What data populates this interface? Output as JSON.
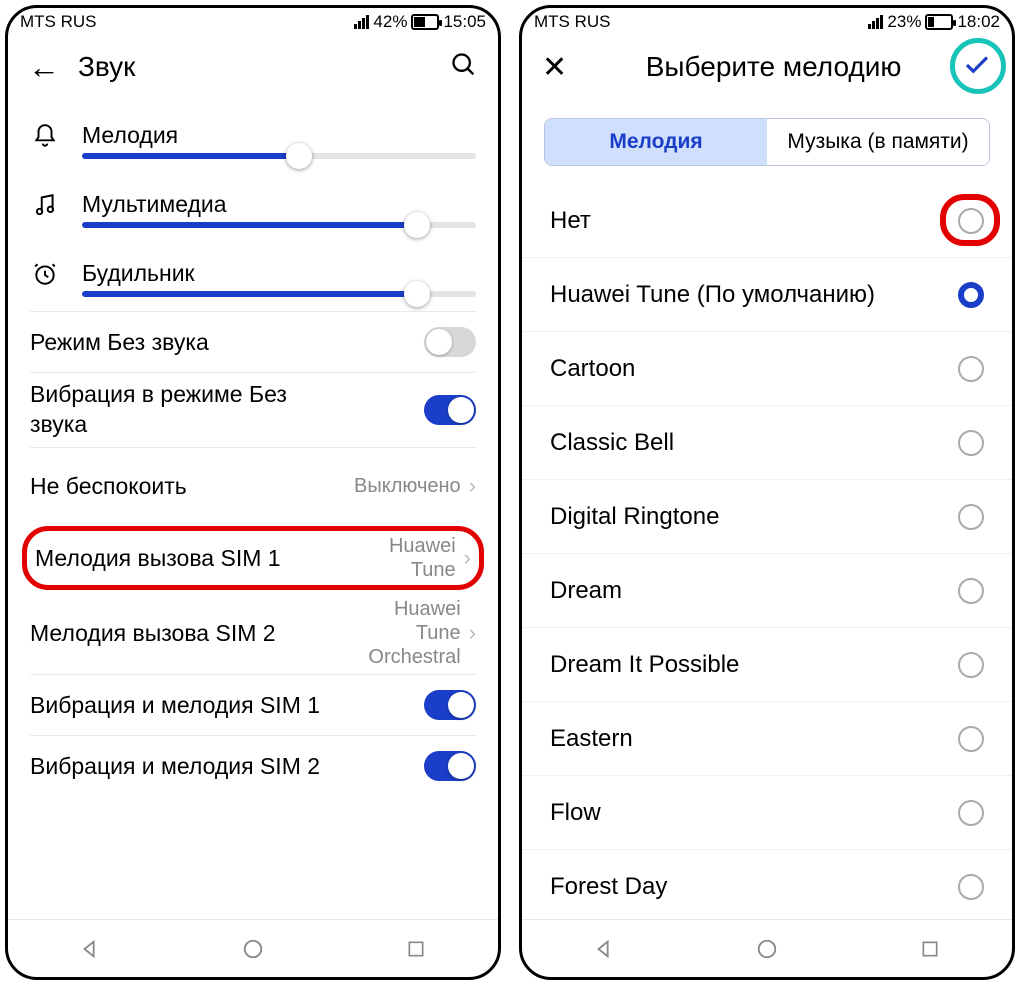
{
  "left": {
    "status": {
      "carrier": "MTS RUS",
      "battery_pct": "42%",
      "time": "15:05"
    },
    "header": {
      "title": "Звук"
    },
    "sliders": [
      {
        "label": "Мелодия",
        "value_pct": 55
      },
      {
        "label": "Мультимедиа",
        "value_pct": 85
      },
      {
        "label": "Будильник",
        "value_pct": 85
      }
    ],
    "toggles": {
      "silent": {
        "label": "Режим Без звука",
        "on": false
      },
      "vibrate_silent": {
        "label_l1": "Вибрация в режиме Без",
        "label_l2": "звука",
        "on": true
      }
    },
    "dnd": {
      "label": "Не беспокоить",
      "value": "Выключено"
    },
    "sim1": {
      "label": "Мелодия вызова SIM 1",
      "value_l1": "Huawei",
      "value_l2": "Tune"
    },
    "sim2": {
      "label": "Мелодия вызова SIM 2",
      "value_l1": "Huawei",
      "value_l2": "Tune",
      "value_l3": "Orchestral"
    },
    "vib_sim1": {
      "label": "Вибрация и мелодия SIM 1",
      "on": true
    },
    "vib_sim2": {
      "label": "Вибрация и мелодия SIM 2",
      "on": true
    }
  },
  "right": {
    "status": {
      "carrier": "MTS RUS",
      "battery_pct": "23%",
      "time": "18:02"
    },
    "header": {
      "title": "Выберите мелодию"
    },
    "tabs": {
      "melody": "Мелодия",
      "music": "Музыка (в памяти)"
    },
    "ringtones": [
      {
        "name": "Нет",
        "selected": false,
        "highlight": true
      },
      {
        "name": "Huawei Tune (По умолчанию)",
        "selected": true
      },
      {
        "name": "Cartoon",
        "selected": false
      },
      {
        "name": "Classic Bell",
        "selected": false
      },
      {
        "name": "Digital Ringtone",
        "selected": false
      },
      {
        "name": "Dream",
        "selected": false
      },
      {
        "name": "Dream It Possible",
        "selected": false
      },
      {
        "name": "Eastern",
        "selected": false
      },
      {
        "name": "Flow",
        "selected": false
      },
      {
        "name": "Forest Day",
        "selected": false
      }
    ]
  }
}
